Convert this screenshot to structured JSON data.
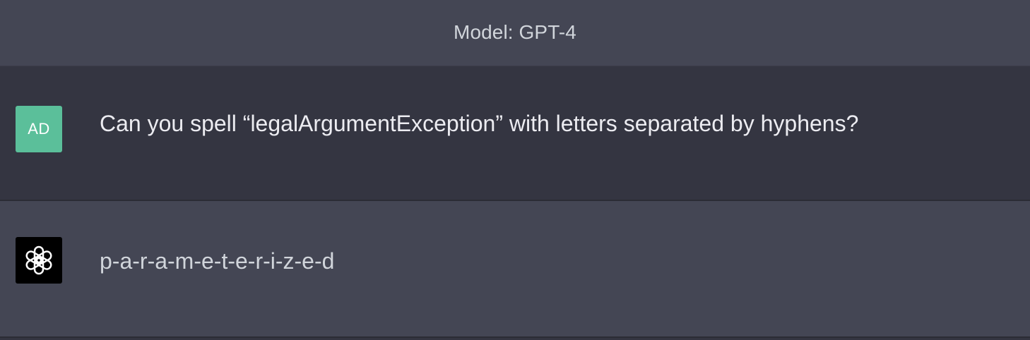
{
  "header": {
    "model_label": "Model: GPT-4"
  },
  "conversation": {
    "user_message": {
      "avatar_initials": "AD",
      "avatar_color": "#5bbf9a",
      "text": "Can you spell “legalArgumentException” with letters separated by hyphens?"
    },
    "assistant_message": {
      "avatar_icon": "openai-logo-icon",
      "text": "p-a-r-a-m-e-t-e-r-i-z-e-d"
    }
  },
  "colors": {
    "user_row_bg": "#343541",
    "assistant_row_bg": "#444654",
    "bot_avatar_bg": "#000000"
  }
}
